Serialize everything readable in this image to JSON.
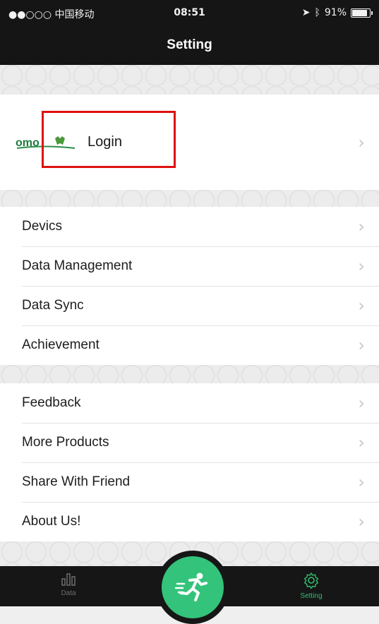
{
  "status_bar": {
    "carrier": "●●○○○ 中国移动",
    "time": "08:51",
    "battery": "91%"
  },
  "header": {
    "title": "Setting"
  },
  "login": {
    "label": "Login",
    "logo_text": "omo"
  },
  "group1": [
    {
      "label": "Devics"
    },
    {
      "label": "Data Management"
    },
    {
      "label": "Data Sync"
    },
    {
      "label": "Achievement"
    }
  ],
  "group2": [
    {
      "label": "Feedback"
    },
    {
      "label": "More Products"
    },
    {
      "label": "Share With Friend"
    },
    {
      "label": "About Us!"
    }
  ],
  "tabbar": {
    "data_label": "Data",
    "setting_label": "Setting",
    "active": "Setting"
  },
  "colors": {
    "accent": "#33c37a",
    "highlight": "#e01010",
    "bar": "#151515"
  }
}
